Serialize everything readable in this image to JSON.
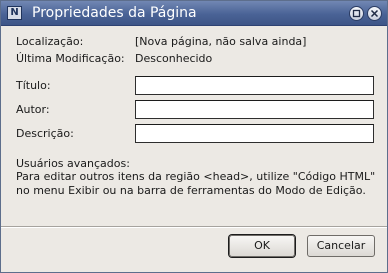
{
  "window": {
    "title": "Propriedades da Página",
    "icon": "N",
    "controls": [
      "maximize-icon",
      "close-icon"
    ]
  },
  "info": {
    "location_label": "Localização:",
    "location_value": "[Nova página, não salva ainda]",
    "modified_label": "Última Modificação:",
    "modified_value": "Desconhecido"
  },
  "fields": {
    "title_label": "Título:",
    "title_value": "",
    "author_label": "Autor:",
    "author_value": "",
    "description_label": "Descrição:",
    "description_value": ""
  },
  "advanced": {
    "heading": "Usuários avançados:",
    "text": "Para editar outros itens da região <head>, utilize \"Código HTML\" no menu Exibir ou na barra de ferramentas do Modo de Edição."
  },
  "buttons": {
    "ok": "OK",
    "cancel": "Cancelar"
  }
}
